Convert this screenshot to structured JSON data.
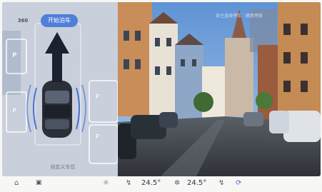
{
  "parking": {
    "btn_360": "360",
    "start_parking": "开始泊车",
    "custom_slot": "自定义车位",
    "slot_letters": [
      "P",
      "P",
      "P",
      "P"
    ]
  },
  "street": {
    "caption": "自主选择停车 · 随意停放"
  },
  "dock": {
    "home_icon": "home-icon",
    "apps_icon": "square-icon",
    "temp_left": "24.5°",
    "temp_right": "24.5°"
  }
}
